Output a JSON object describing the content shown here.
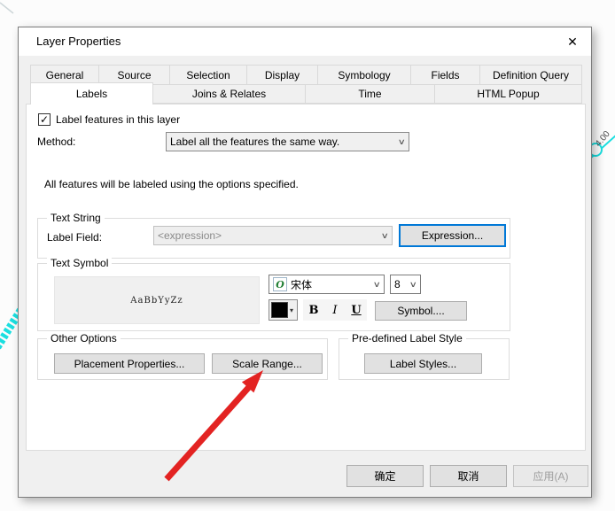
{
  "window": {
    "title": "Layer Properties"
  },
  "icons": {
    "close": "✕",
    "check": "✓",
    "chevron": "∨",
    "dropdown_arrow": "▾",
    "font_type": "O"
  },
  "tabs": {
    "row1": [
      {
        "label": "General"
      },
      {
        "label": "Source"
      },
      {
        "label": "Selection"
      },
      {
        "label": "Display"
      },
      {
        "label": "Symbology"
      },
      {
        "label": "Fields"
      },
      {
        "label": "Definition Query"
      }
    ],
    "row2": [
      {
        "label": "Labels",
        "selected": true
      },
      {
        "label": "Joins & Relates"
      },
      {
        "label": "Time"
      },
      {
        "label": "HTML Popup"
      }
    ]
  },
  "labels_tab": {
    "checkbox_label": "Label features in this layer",
    "checkbox_checked": true,
    "method_label": "Method:",
    "method_value": "Label all the features the same way.",
    "description": "All features will be labeled using the options specified.",
    "text_string": {
      "legend": "Text String",
      "field_label": "Label Field:",
      "field_value": "<expression>",
      "expression_button": "Expression..."
    },
    "text_symbol": {
      "legend": "Text Symbol",
      "preview_text": "AaBbYyZz",
      "font_name": "宋体",
      "font_size": "8",
      "bold_label": "B",
      "italic_label": "I",
      "underline_label": "U",
      "color_value": "#000000",
      "symbol_button": "Symbol...."
    },
    "other_options": {
      "legend": "Other Options",
      "placement_button": "Placement Properties...",
      "scale_range_button": "Scale Range..."
    },
    "predefined_style": {
      "legend": "Pre-defined Label Style",
      "label_styles_button": "Label Styles..."
    }
  },
  "footer": {
    "ok_button": "确定",
    "cancel_button": "取消",
    "apply_button": "应用(A)"
  },
  "map_background": {
    "annotation_text": "4.00",
    "feature_color": "#1adfe0",
    "arrow_color": "#e32322"
  }
}
